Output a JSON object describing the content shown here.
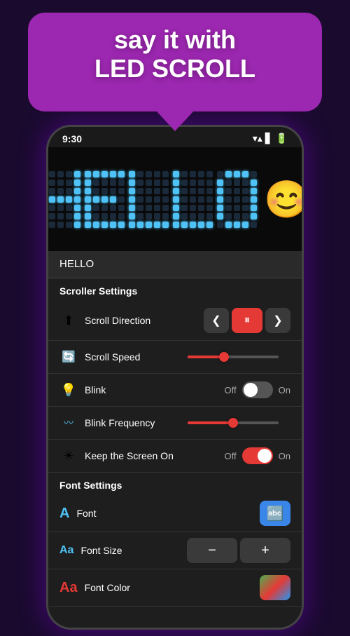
{
  "banner": {
    "line1": "say it with",
    "line2": "LED SCROLL"
  },
  "phone": {
    "status": {
      "time": "9:30"
    },
    "led_display": {
      "text": "HELLO",
      "emoji": "😊"
    },
    "text_input": {
      "value": "HELLO"
    },
    "scroller_settings": {
      "section_label": "Scroller Settings",
      "scroll_direction": {
        "label": "Scroll Direction",
        "icon": "⬆"
      },
      "scroll_speed": {
        "label": "Scroll Speed",
        "fill_percent": 40
      },
      "blink": {
        "label": "Blink",
        "off_label": "Off",
        "on_label": "On",
        "state": "off"
      },
      "blink_frequency": {
        "label": "Blink Frequency",
        "fill_percent": 50
      },
      "keep_screen_on": {
        "label": "Keep the Screen On",
        "off_label": "Off",
        "on_label": "On",
        "state": "on"
      }
    },
    "font_settings": {
      "section_label": "Font Settings",
      "font": {
        "label": "Font",
        "icon": "A"
      },
      "font_size": {
        "label": "Font Size",
        "minus": "−",
        "plus": "+"
      },
      "font_color": {
        "label": "Font Color",
        "icon": "A"
      }
    }
  },
  "icons": {
    "left_arrow": "❮",
    "right_arrow": "❯",
    "pause": "⏸",
    "wifi": "▲",
    "signal": "▲",
    "battery": "▮"
  }
}
